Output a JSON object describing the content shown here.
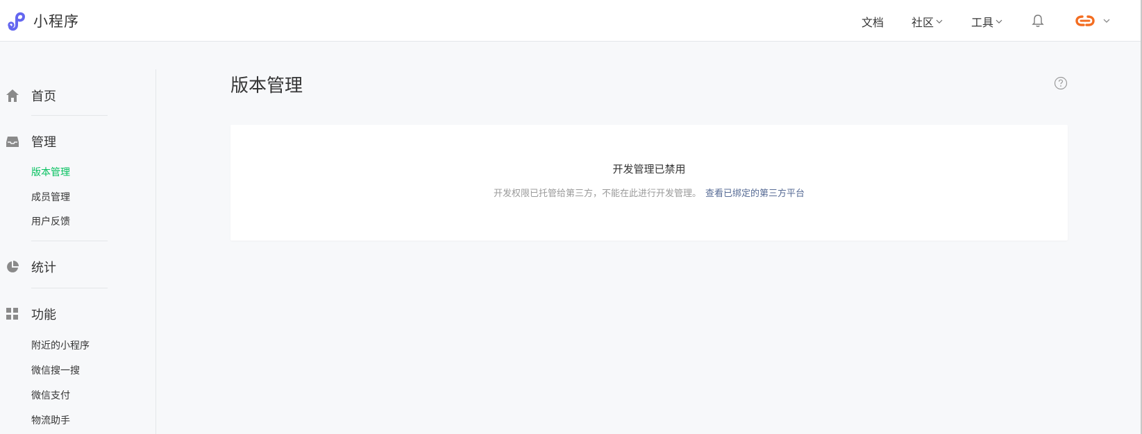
{
  "app": {
    "brand_name": "小程序"
  },
  "header": {
    "nav": [
      {
        "label": "文档"
      },
      {
        "label": "社区"
      },
      {
        "label": "工具"
      }
    ]
  },
  "sidebar": {
    "sections": [
      {
        "label": "首页",
        "icon": "home-icon"
      },
      {
        "label": "管理",
        "icon": "inbox-icon",
        "items": [
          "版本管理",
          "成员管理",
          "用户反馈"
        ],
        "active_item": "版本管理"
      },
      {
        "label": "统计",
        "icon": "pie-chart-icon"
      },
      {
        "label": "功能",
        "icon": "grid-icon",
        "items": [
          "附近的小程序",
          "微信搜一搜",
          "微信支付",
          "物流助手"
        ]
      }
    ]
  },
  "main": {
    "title": "版本管理",
    "notice": {
      "title": "开发管理已禁用",
      "description": "开发权限已托管给第三方，不能在此进行开发管理。",
      "link_text": "查看已绑定的第三方平台"
    }
  },
  "colors": {
    "brand_purple": "#6467f0",
    "active_green": "#07c160",
    "link_blue": "#576b95",
    "avatar_orange": "#f36d21"
  }
}
